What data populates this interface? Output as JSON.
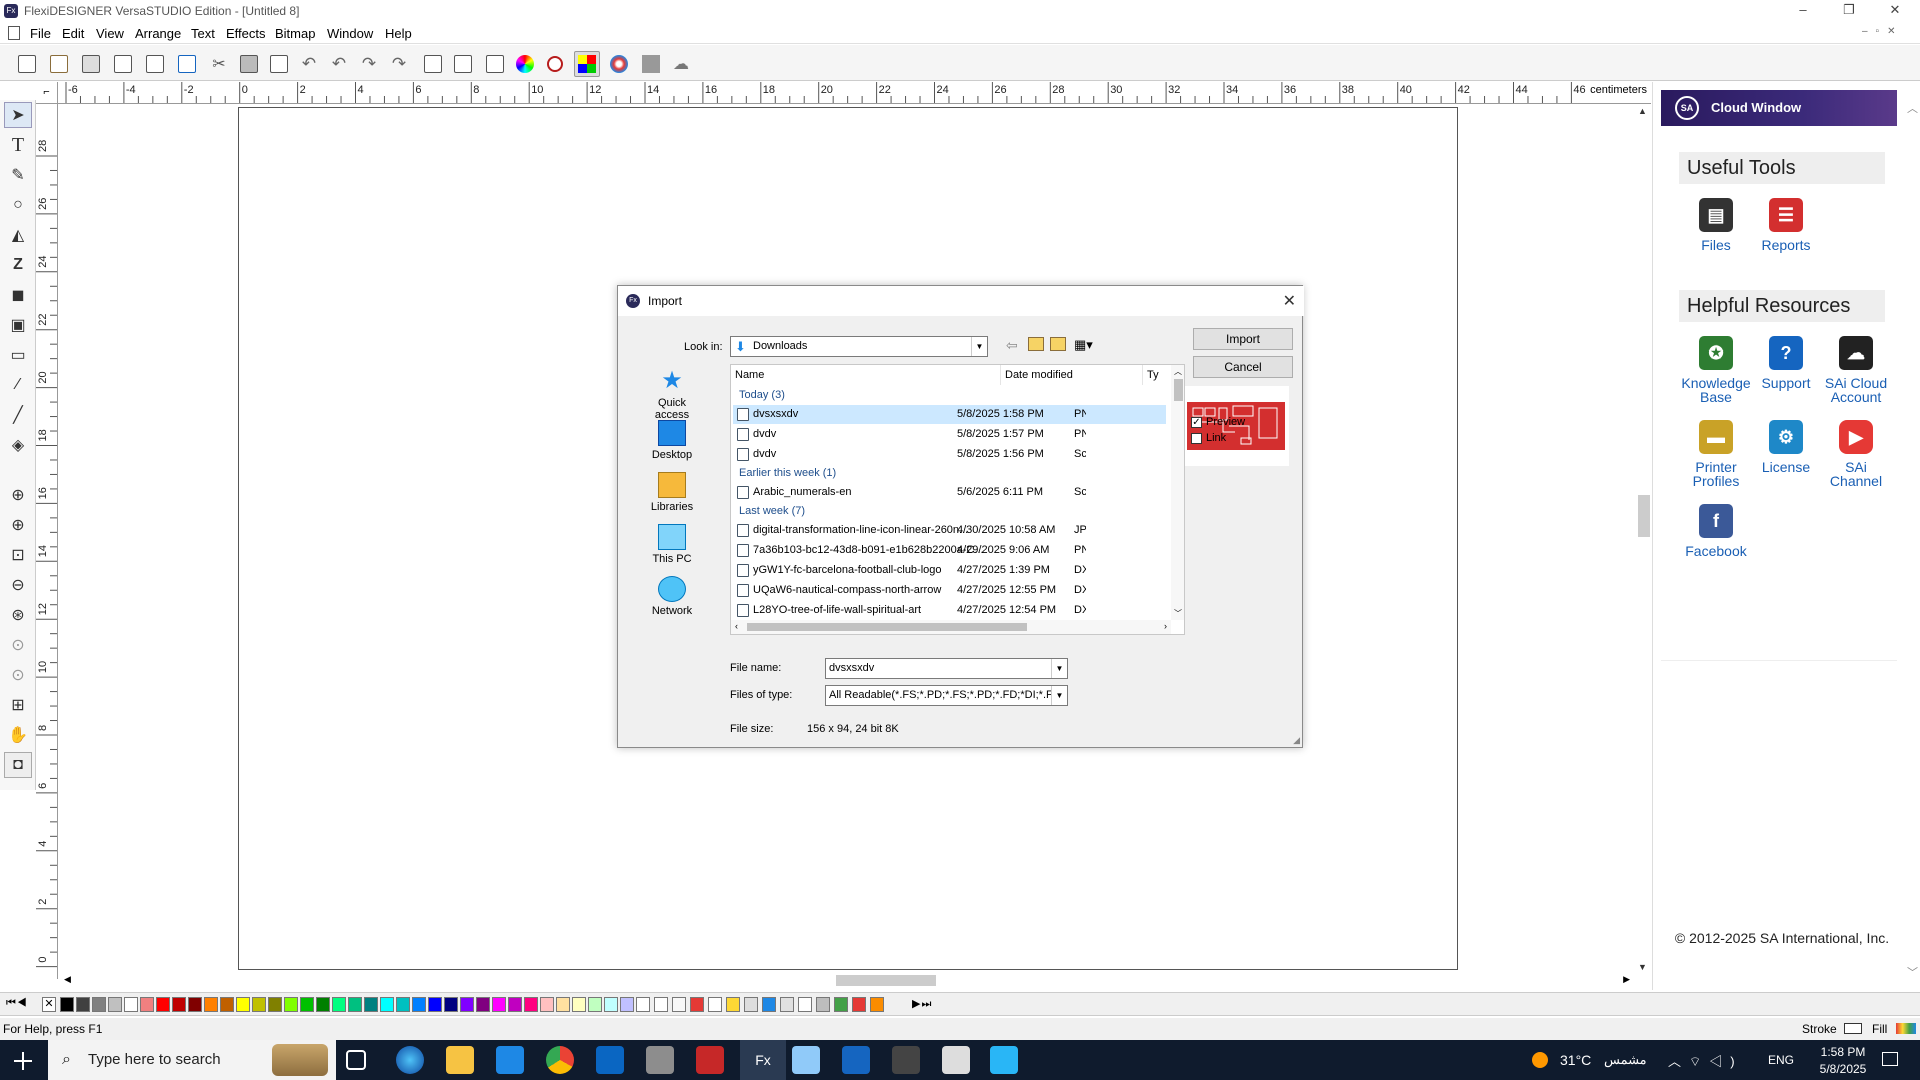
{
  "window": {
    "title": "FlexiDESIGNER VersaSTUDIO Edition - [Untitled 8]",
    "controls": {
      "minimize": "–",
      "restore": "❐",
      "close": "✕"
    }
  },
  "menu": [
    "File",
    "Edit",
    "View",
    "Arrange",
    "Text",
    "Effects",
    "Bitmap",
    "Window",
    "Help"
  ],
  "ruler": {
    "unit": "centimeters",
    "h_ticks": [
      "-6",
      "-4",
      "-2",
      "0",
      "2",
      "4",
      "6",
      "8",
      "10",
      "12",
      "14",
      "16",
      "18",
      "20",
      "22",
      "24",
      "26",
      "28",
      "30",
      "32",
      "34",
      "36",
      "38",
      "40",
      "42",
      "44",
      "46"
    ],
    "v_ticks": [
      "28",
      "26",
      "24",
      "22",
      "20",
      "18",
      "16",
      "14",
      "12",
      "10",
      "8",
      "6",
      "4",
      "2",
      "0"
    ]
  },
  "cloud_window": {
    "title": "Cloud Window",
    "useful_tools_title": "Useful Tools",
    "useful_tools": [
      {
        "label": "Files",
        "icon": "files-icon",
        "color": "#333333"
      },
      {
        "label": "Reports",
        "icon": "reports-icon",
        "color": "#d32f2f"
      }
    ],
    "helpful_resources_title": "Helpful Resources",
    "helpful_resources": [
      {
        "label": "Knowledge Base",
        "icon": "knowledge-base-icon",
        "color": "#2e7d32"
      },
      {
        "label": "Support",
        "icon": "support-icon",
        "color": "#1565c0"
      },
      {
        "label": "SAi Cloud Account",
        "icon": "cloud-account-icon",
        "color": "#222222"
      },
      {
        "label": "Printer Profiles",
        "icon": "printer-profiles-icon",
        "color": "#c9a227"
      },
      {
        "label": "License",
        "icon": "license-icon",
        "color": "#1e88c8"
      },
      {
        "label": "SAi Channel",
        "icon": "youtube-icon",
        "color": "#e53935"
      },
      {
        "label": "Facebook",
        "icon": "facebook-icon",
        "color": "#3b5998"
      }
    ],
    "copyright": "© 2012-2025 SA International, Inc."
  },
  "dialog": {
    "title": "Import",
    "look_in_label": "Look in:",
    "look_in_value": "Downloads",
    "import_button": "Import",
    "cancel_button": "Cancel",
    "places": [
      "Quick access",
      "Desktop",
      "Libraries",
      "This PC",
      "Network"
    ],
    "columns": {
      "name": "Name",
      "date": "Date modified",
      "type": "Ty"
    },
    "groups": [
      {
        "label": "Today (3)",
        "rows": [
          {
            "name": "dvsxsxdv",
            "date": "5/8/2025 1:58 PM",
            "type": "PN",
            "selected": true
          },
          {
            "name": "dvdv",
            "date": "5/8/2025 1:57 PM",
            "type": "PN"
          },
          {
            "name": "dvdv",
            "date": "5/8/2025 1:56 PM",
            "type": "Sc"
          }
        ]
      },
      {
        "label": "Earlier this week (1)",
        "rows": [
          {
            "name": "Arabic_numerals-en",
            "date": "5/6/2025 6:11 PM",
            "type": "Sc"
          }
        ]
      },
      {
        "label": "Last week (7)",
        "rows": [
          {
            "name": "digital-transformation-line-icon-linear-260n...",
            "date": "4/30/2025 10:58 AM",
            "type": "JP"
          },
          {
            "name": "7a36b103-bc12-43d8-b091-e1b628b2200a-C...",
            "date": "4/29/2025 9:06 AM",
            "type": "PN"
          },
          {
            "name": "yGW1Y-fc-barcelona-football-club-logo",
            "date": "4/27/2025 1:39 PM",
            "type": "DX"
          },
          {
            "name": "UQaW6-nautical-compass-north-arrow",
            "date": "4/27/2025 12:55 PM",
            "type": "DX"
          },
          {
            "name": "L28YO-tree-of-life-wall-spiritual-art",
            "date": "4/27/2025 12:54 PM",
            "type": "DX"
          }
        ]
      }
    ],
    "file_name_label": "File name:",
    "file_name_value": "dvsxsxdv",
    "files_of_type_label": "Files of type:",
    "files_of_type_value": "All Readable(*.FS;*.PD;*.FS;*.PD;*.FD;*DI;*.FC",
    "file_size_label": "File size:",
    "file_size_value": "156 x 94, 24 bit 8K",
    "preview_label": "Preview",
    "preview_checked": true,
    "link_label": "Link",
    "link_checked": false
  },
  "status": {
    "hint": "For Help, press F1",
    "stroke_label": "Stroke",
    "fill_label": "Fill"
  },
  "palette_colors": [
    "#000000",
    "#404040",
    "#808080",
    "#c0c0c0",
    "#ffffff",
    "#f08080",
    "#ff0000",
    "#c00000",
    "#800000",
    "#ff8000",
    "#c06000",
    "#ffff00",
    "#c0c000",
    "#808000",
    "#80ff00",
    "#00c000",
    "#008000",
    "#00ff80",
    "#00c080",
    "#008080",
    "#00ffff",
    "#00c0c0",
    "#0080ff",
    "#0000ff",
    "#000080",
    "#8000ff",
    "#800080",
    "#ff00ff",
    "#c000c0",
    "#ff0080",
    "#ffc0c0",
    "#ffe0a0",
    "#ffffc0",
    "#c0ffc0",
    "#c0ffff",
    "#c0c0ff"
  ],
  "taskbar": {
    "search_placeholder": "Type here to search",
    "weather": "31°C",
    "weather_desc": "مشمس",
    "lang": "ENG",
    "time": "1:58 PM",
    "date": "5/8/2025"
  }
}
